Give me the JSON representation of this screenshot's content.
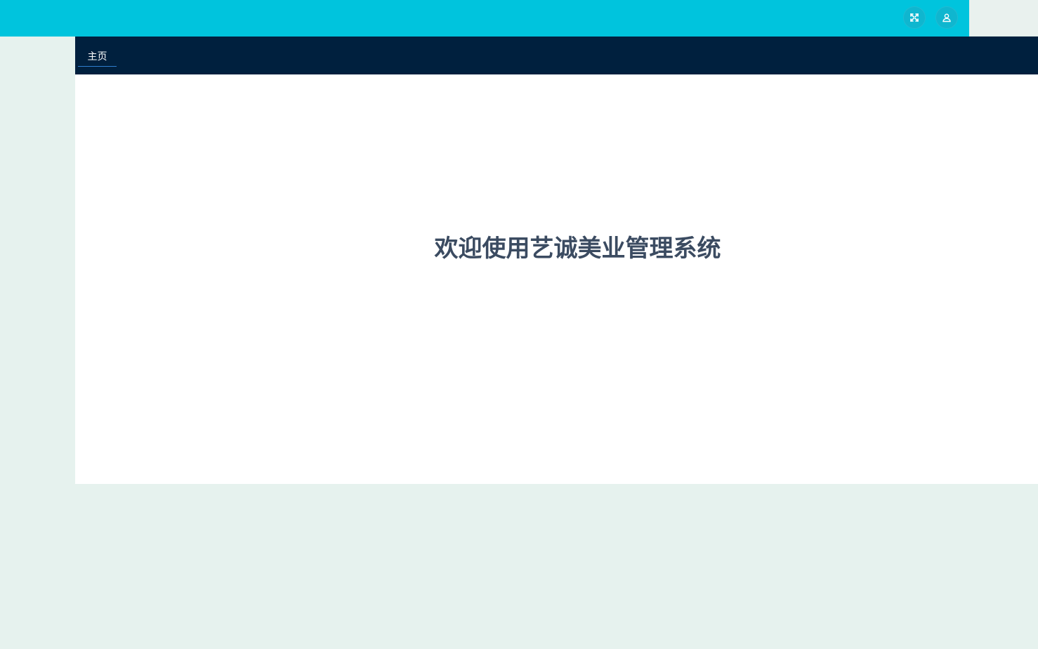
{
  "header": {
    "fullscreen_icon": "fullscreen-icon",
    "user_icon": "user-icon",
    "accent_color": "#00c4dd"
  },
  "tabs": [
    {
      "label": "主页",
      "active": true
    }
  ],
  "main": {
    "welcome_text": "欢迎使用艺诚美业管理系统"
  }
}
